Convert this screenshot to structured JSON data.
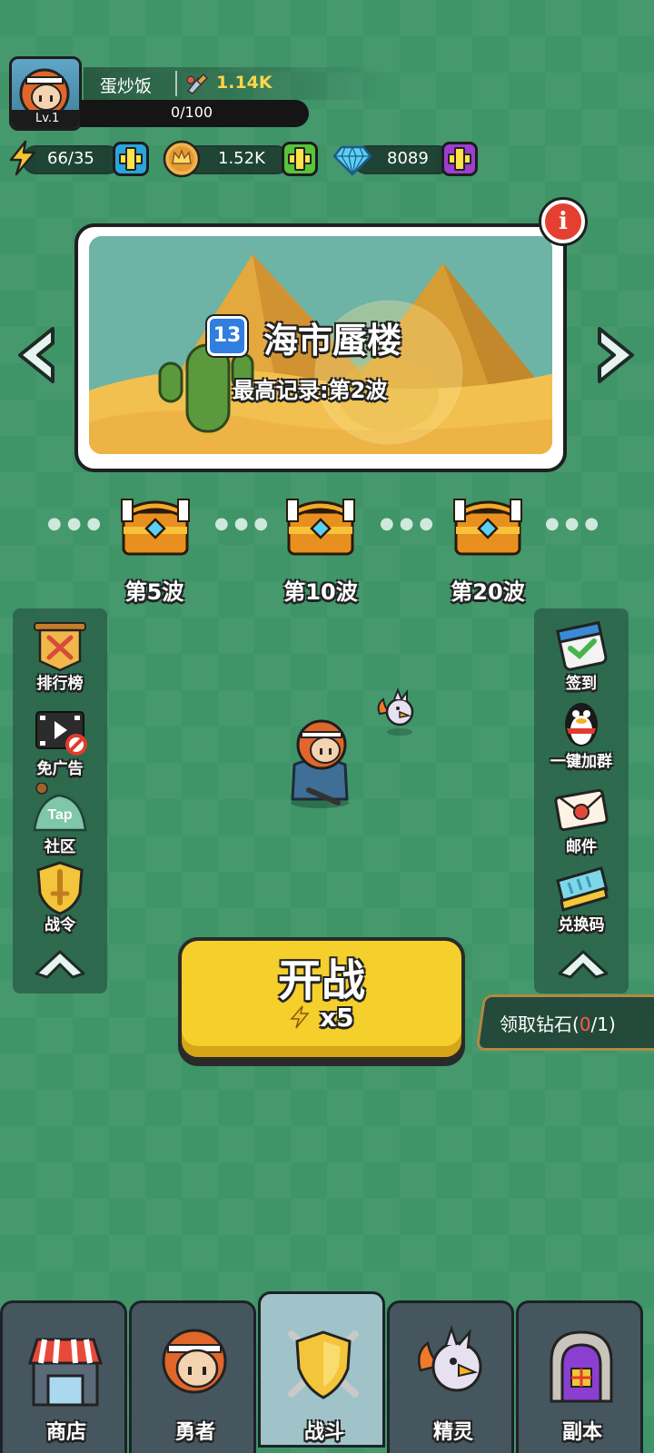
{
  "player": {
    "name": "蛋炒饭",
    "level": "Lv.1",
    "power": "1.14K",
    "exp": "0/100"
  },
  "resources": {
    "energy": "66/35",
    "coins": "1.52K",
    "gems": "8089"
  },
  "stage": {
    "number": "13",
    "title": "海市蜃楼",
    "record": "最高记录:第2波"
  },
  "waves": [
    "第5波",
    "第10波",
    "第20波"
  ],
  "left_menu": {
    "rank": "排行榜",
    "no_ads": "免广告",
    "community_tag": "Tap",
    "community": "社区",
    "battle_pass": "战令"
  },
  "right_menu": {
    "checkin": "签到",
    "join_group": "一键加群",
    "mail": "邮件",
    "redeem": "兑换码"
  },
  "start": {
    "label": "开战",
    "cost": "x5"
  },
  "diamond_claim": {
    "prefix": "领取钻石(",
    "count": "0",
    "suffix": "/1)"
  },
  "nav": [
    "商店",
    "勇者",
    "战斗",
    "精灵",
    "副本"
  ]
}
